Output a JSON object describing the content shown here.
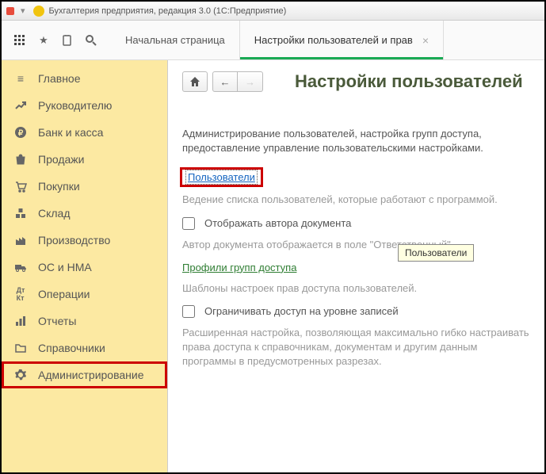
{
  "titlebar": {
    "app_title": "Бухгалтерия предприятия, редакция 3.0  (1С:Предприятие)"
  },
  "tabs": {
    "home": "Начальная страница",
    "settings": "Настройки пользователей и прав"
  },
  "sidebar": {
    "items": [
      {
        "label": "Главное"
      },
      {
        "label": "Руководителю"
      },
      {
        "label": "Банк и касса"
      },
      {
        "label": "Продажи"
      },
      {
        "label": "Покупки"
      },
      {
        "label": "Склад"
      },
      {
        "label": "Производство"
      },
      {
        "label": "ОС и НМА"
      },
      {
        "label": "Операции"
      },
      {
        "label": "Отчеты"
      },
      {
        "label": "Справочники"
      },
      {
        "label": "Администрирование"
      }
    ]
  },
  "main": {
    "page_title": "Настройки пользователей",
    "page_desc": "Администрирование пользователей, настройка групп доступа, предоставление управление пользовательскими настройками.",
    "users_link": "Пользователи",
    "users_desc": "Ведение списка пользователей, которые работают с программой.",
    "checkbox_author": "Отображать автора документа",
    "author_desc": "Автор документа отображается в поле \"Ответственный\".",
    "profiles_link": "Профили групп доступа",
    "profiles_desc": "Шаблоны настроек прав доступа пользователей.",
    "checkbox_restrict": "Ограничивать доступ на уровне записей",
    "restrict_desc": "Расширенная настройка, позволяющая максимально гибко настраивать права доступа к справочникам, документам и другим данным программы в предусмотренных разрезах.",
    "tooltip": "Пользователи"
  }
}
